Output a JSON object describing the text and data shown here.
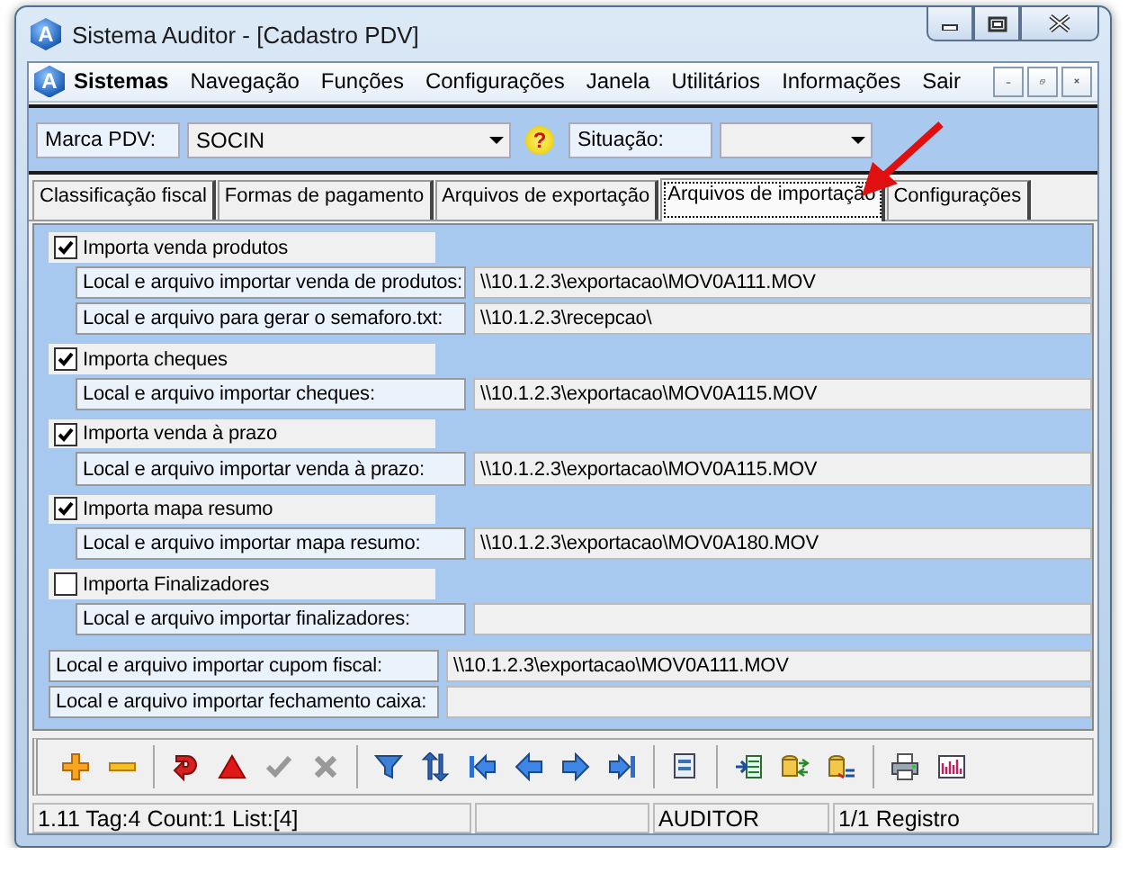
{
  "window": {
    "title": "Sistema Auditor - [Cadastro PDV]",
    "logo": "A"
  },
  "menu": {
    "logo": "A",
    "app_label": "Sistemas",
    "items": [
      "Navegação",
      "Funções",
      "Configurações",
      "Janela",
      "Utilitários",
      "Informações",
      "Sair"
    ]
  },
  "filter": {
    "brand_label": "Marca PDV:",
    "brand_value": "SOCIN",
    "help": "?",
    "status_label": "Situação:"
  },
  "tabs": [
    {
      "label": "Classificação fiscal",
      "selected": false
    },
    {
      "label": "Formas de pagamento",
      "selected": false
    },
    {
      "label": "Arquivos de exportação",
      "selected": false
    },
    {
      "label": "Arquivos de importação",
      "selected": true
    },
    {
      "label": "Configurações",
      "selected": false
    }
  ],
  "groups": [
    {
      "label": "Importa venda produtos",
      "checked": true,
      "fields": [
        {
          "label": "Local e arquivo importar venda de produtos:",
          "value": "\\\\10.1.2.3\\exportacao\\MOV0A111.MOV"
        },
        {
          "label": "Local e arquivo para gerar o semaforo.txt:",
          "value": "\\\\10.1.2.3\\recepcao\\"
        }
      ]
    },
    {
      "label": "Importa cheques",
      "checked": true,
      "fields": [
        {
          "label": "Local e arquivo importar cheques:",
          "value": "\\\\10.1.2.3\\exportacao\\MOV0A115.MOV"
        }
      ]
    },
    {
      "label": "Importa venda à prazo",
      "checked": true,
      "fields": [
        {
          "label": "Local e arquivo importar venda à prazo:",
          "value": "\\\\10.1.2.3\\exportacao\\MOV0A115.MOV"
        }
      ]
    },
    {
      "label": "Importa mapa resumo",
      "checked": true,
      "fields": [
        {
          "label": "Local e arquivo importar mapa resumo:",
          "value": "\\\\10.1.2.3\\exportacao\\MOV0A180.MOV"
        }
      ]
    },
    {
      "label": "Importa Finalizadores",
      "checked": false,
      "fields": [
        {
          "label": "Local e arquivo importar finalizadores:"
        }
      ]
    }
  ],
  "extra_fields": [
    {
      "label": "Local e arquivo importar cupom fiscal:",
      "value": "\\\\10.1.2.3\\exportacao\\MOV0A111.MOV"
    },
    {
      "label": "Local e arquivo importar fechamento caixa:"
    }
  ],
  "toolbar": [
    [
      {
        "kind": "add",
        "disabled": false
      },
      {
        "kind": "remove",
        "disabled": false
      }
    ],
    [
      {
        "kind": "undo",
        "disabled": false
      },
      {
        "kind": "alert",
        "disabled": false
      },
      {
        "kind": "confirm",
        "disabled": true
      },
      {
        "kind": "cancel",
        "disabled": true
      }
    ],
    [
      {
        "kind": "filter",
        "disabled": false
      },
      {
        "kind": "sort",
        "disabled": false
      },
      {
        "kind": "first",
        "disabled": false
      },
      {
        "kind": "prev",
        "disabled": false
      },
      {
        "kind": "next",
        "disabled": false
      },
      {
        "kind": "last",
        "disabled": false
      }
    ],
    [
      {
        "kind": "form",
        "disabled": false
      }
    ],
    [
      {
        "kind": "import",
        "disabled": false
      },
      {
        "kind": "sync",
        "disabled": false
      },
      {
        "kind": "query",
        "disabled": false
      }
    ],
    [
      {
        "kind": "print",
        "disabled": false
      },
      {
        "kind": "chart",
        "disabled": false
      }
    ]
  ],
  "status_bar": {
    "info": "1.11 Tag:4 Count:1 List:[4]",
    "user": "AUDITOR",
    "records": "1/1 Registro"
  }
}
